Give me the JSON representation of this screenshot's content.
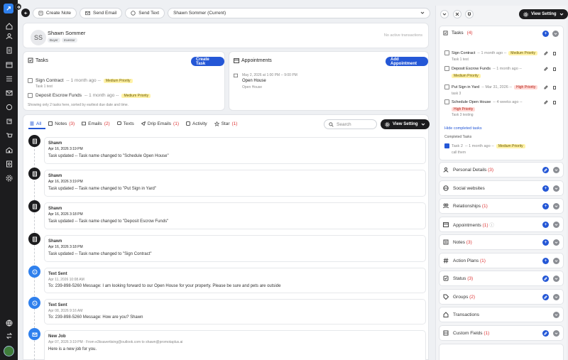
{
  "topbar": {
    "create_note": "Create Note",
    "send_email": "Send Email",
    "send_text": "Send Text",
    "contact_select": "Shawn Sommer (Current)"
  },
  "contact": {
    "initials": "SS",
    "name": "Shawn Sommer",
    "tags": [
      "Buyer",
      "Investor"
    ],
    "transactions_note": "No active transactions"
  },
  "tasks_panel": {
    "title": "Tasks",
    "create_label": "Create Task",
    "items": [
      {
        "title": "Sign Contract",
        "when": "-- 1 month ago --",
        "priority": "Medium Priority",
        "desc": "Task 1 test"
      },
      {
        "title": "Deposit Escrow Funds",
        "when": "-- 1 month ago --",
        "priority": "Medium Priority",
        "desc": ""
      }
    ],
    "footer": "Showing only 2 tasks here, sorted by earliest due date and time."
  },
  "appointments_panel": {
    "title": "Appointments",
    "add_label": "Add Appointment",
    "item": {
      "when": "May 2, 2026 at 1:00 PM -- 9:00 PM",
      "title": "Open House",
      "desc": "Open House"
    }
  },
  "tabs": [
    {
      "label": "All",
      "count": ""
    },
    {
      "label": "Notes",
      "count": "(3)"
    },
    {
      "label": "Emails",
      "count": "(2)"
    },
    {
      "label": "Texts",
      "count": ""
    },
    {
      "label": "Drip Emails",
      "count": "(1)"
    },
    {
      "label": "Activity",
      "count": ""
    },
    {
      "label": "Star",
      "count": "(1)"
    }
  ],
  "search": {
    "placeholder": "Search"
  },
  "view_setting_label": "View Setting",
  "activities": [
    {
      "who": "Shawn",
      "when": "Apr 16, 2026 3:19 PM",
      "msg": "Task updated -- Task name changed to \"Schedule Open House\""
    },
    {
      "who": "Shawn",
      "when": "Apr 16, 2026 3:19 PM",
      "msg": "Task updated -- Task name changed to \"Put Sign in Yard\""
    },
    {
      "who": "Shawn",
      "when": "Apr 16, 2026 3:18 PM",
      "msg": "Task updated -- Task name changed to \"Deposit Escrow Funds\""
    },
    {
      "who": "Shawn",
      "when": "Apr 16, 2026 3:18 PM",
      "msg": "Task updated -- Task name changed to \"Sign Contract\""
    },
    {
      "who": "Text Sent",
      "when": "Apr 11, 2026 10:08 AM",
      "msg": "To: 239-898-5260 Message: I am looking forward to our Open House for your property. Please be sure and pets are outside"
    },
    {
      "who": "Text Sent",
      "when": "Apr 08, 2026 9:16 AM",
      "msg": "To: 239-898-5260 Message: How are you? Shawn"
    },
    {
      "who": "New Job",
      "when": "Apr 07, 2026 3:19 PM · From e3ksavertising@outlook.com to shawn@promotaplus.ai",
      "msg": "Here is a new job for you."
    }
  ],
  "right_panel": {
    "view_setting_label": "View Setting",
    "tasks_title": "Tasks",
    "tasks_count": "(4)",
    "tasks": [
      {
        "title": "Sign Contract",
        "when": "-- 1 month ago --",
        "priority": "Medium Priority",
        "desc": "Task 1 test"
      },
      {
        "title": "Deposit Escrow Funds",
        "when": "-- 1 month ago --",
        "priority": "Medium Priority",
        "desc": ""
      },
      {
        "title": "Put Sign in Yard",
        "when": "-- Mar 31, 2026 --",
        "priority": "High Priority",
        "desc": "task 3"
      },
      {
        "title": "Schedule Open House",
        "when": "-- 4 weeks ago --",
        "priority": "High Priority",
        "desc": "Task 3 testing"
      }
    ],
    "hide_completed": "Hide completed tasks",
    "completed_title": "Completed Tasks",
    "completed": {
      "title": "Task 2",
      "when": "-- 1 month ago --",
      "priority": "Medium Priority",
      "desc": "call them"
    },
    "sections": [
      {
        "label": "Personal Details",
        "count": "(3)"
      },
      {
        "label": "Social websites",
        "count": ""
      },
      {
        "label": "Relationships",
        "count": "(1)"
      },
      {
        "label": "Appointments",
        "count": "(1)"
      },
      {
        "label": "Notes",
        "count": "(3)"
      },
      {
        "label": "Action Plans",
        "count": "(1)"
      },
      {
        "label": "Status",
        "count": "(3)"
      },
      {
        "label": "Groups",
        "count": "(2)"
      },
      {
        "label": "Transactions",
        "count": ""
      },
      {
        "label": "Custom Fields",
        "count": "(1)"
      }
    ]
  }
}
